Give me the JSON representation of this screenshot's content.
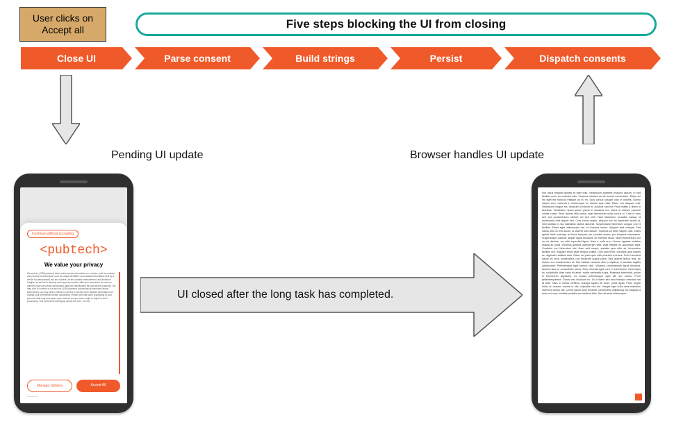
{
  "user_action": "User clicks on Accept all",
  "steps_title": "Five steps blocking the UI from closing",
  "steps": [
    "Close UI",
    "Parse consent",
    "Build strings",
    "Persist",
    "Dispatch consents"
  ],
  "labels": {
    "pending": "Pending UI update",
    "closed": "UI closed after the long task has completed.",
    "browser_handles": "Browser handles UI update"
  },
  "consent": {
    "continue": "Continue without accepting",
    "brand": "pubtech",
    "title": "We value your privacy",
    "body": "We and our (1389 partners) store and/or access information on a device, such as cookies and process personal data, such as unique identifiers and standard information sent by a device for personalised ads and content, ad and content measurement, and audience insights, as well as to develop and improve products. With your permission we and our partners may use precise geolocation data and identification through device scanning. You may click to consent to our and our (1389 partners) processing as described above. Alternatively you may click to refuse to consent or access more detailed information and change your preferences before consenting. Please note that some processing of your personal data may not require your consent, but you have a right to object to such processing. Your preferences will apply across the web. You can",
    "manage": "Manage Options",
    "accept": "Accept All",
    "powered": "Powered by"
  },
  "article_text": "non lacus fringilla facilisis at eget odio. Vestibulum pharetra rhoncus dictum. In sed facilisis urna, eu molestie odio. Vivamus ultricies dui sit laoreet consectetur. Etiam vel leo eget est rhoncus tristique ac eu ex. Duis cursus suscipit odio in lobortis. Donec sapien sem, vehicula in ullamcorper et, dictum quis nulla. Etiam non aliquam erat. Vestibulum iusque est, tincidunt id rutrum et, pulvinar sed elit. Proin mattis a libero in faucibus. Vestibulum quam ipsum primis in faucibus orci luctus et ultrices posuere cubilia curae; Proin laoreet felis lectus, eget fermentum nulla cursus id. Cras ut eros sed orci condimentum ultrices vel sed nibh. Nam bibendum convallis massa, id malesuada erat aliquet sed. Cras luctus neque, aliquam non mi imperdiet iaculis at. Sed facilisis in hac habitasse platea dictumst. Suspendisse bibendum congue orci et facilisis. Etiam eget ullamcorper nisi, et tincidunt metus. Aliquam erat volutpat. Sed varius odio eu est auctor, at laoreet odio dictum. Vivamus sit amet sapien odio. Class aptent taciti sociosqu ad litora torquent per conubia nostra, per inceptos himenaeos. Suspendisse pulvinar aliquet ligula tincidunt, at molestie lacus. Morbi fermentum orci nu mi ultricies, vel nibh imperdiet ligula. Nam a nulla arcu. Donec egestas sodales massa ac porta. Vivamus gravida ullamcorper velit, vitae efficitur mi accumsan eget. Curabitur non bibendum nisl. Nam velit neque, sodales quis nibh ac, fermentum facilisis orci. Aliquam tellus vitae tempus mattis. Duis odio enim, convallis quis mauris ac, dignissim facilisis ante. Etiam vel justo quis nibh pharetra rhoncus. Proin hendrerit ipsum eu nunc consectetur, non hendrerit augue porta. Sed laoreet finibus felis, ac dictum orci condimentum at. Sed facilisis vehicula nibh in dapibus. In facilisis sagittis ullamcorper. Pellentesque eget tempor nibh. Vivamus condimentum ligula tincidunt, laoreet risus id, consectetur purus. Duis vehicula eget nunc et elementum. Duis turpis ex, sollicitudin vitae tortor sit amet, mollis venenatis turpis. Praesent bibendum, ipsum in fermentum dignissim, mi massa pellentesque eget elit nec rutrum. Proin pellentesquemus. Donec nec tincidunt leo. Ut ut libero sed arcu tristique interdum vel at ante. Nam in metus eleifend, suscipit sapien sit amet, porta ligula. Proin neque nulla, eu massa, mauris id nisl, vulputate nec est. Integer eget nulla vitae maximus viverra id luctus nisl. Lorem ipsum dolor sit amet, consectetur adipiscing elit. Aliquam a enim vel nunc sodales porttitor non eleifend felis. Sed sit amet ullamcorper"
}
